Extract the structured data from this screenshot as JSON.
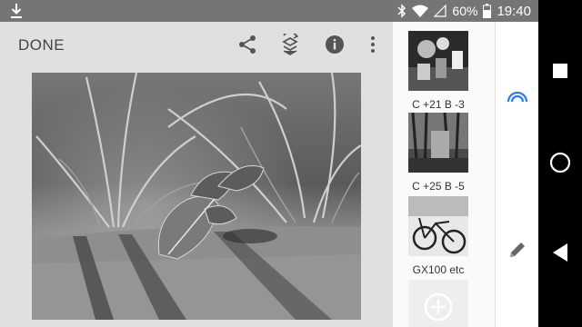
{
  "status_bar": {
    "battery_percent": "60%",
    "time": "19:40",
    "icons": [
      "download-icon",
      "bluetooth-icon",
      "wifi-icon",
      "signal-icon",
      "battery-icon"
    ]
  },
  "toolbar": {
    "done_label": "DONE",
    "icons": [
      "share-icon",
      "stack-icon",
      "info-icon",
      "more-icon"
    ]
  },
  "looks": {
    "items": [
      {
        "label": "C +21 B -3"
      },
      {
        "label": "C +25 B -5"
      },
      {
        "label": "GX100 etc"
      }
    ],
    "add_icon": "add-icon"
  },
  "side_panel": {
    "icons": [
      "looks-arc-icon",
      "pencil-icon"
    ],
    "accent": "#2979ff"
  },
  "navigation": {
    "icons": [
      "recents-icon",
      "home-icon",
      "back-icon"
    ]
  }
}
